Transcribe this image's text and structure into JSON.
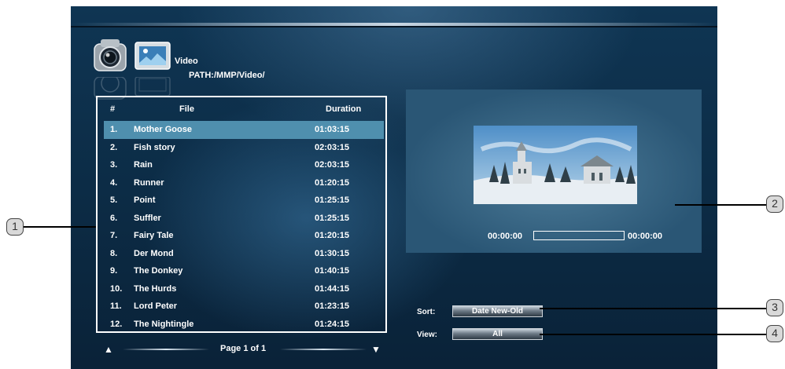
{
  "header": {
    "title": "Video",
    "path": "PATH:/MMP/Video/"
  },
  "list": {
    "columns": {
      "num": "#",
      "file": "File",
      "duration": "Duration"
    },
    "rows": [
      {
        "num": "1.",
        "file": "Mother Goose",
        "duration": "01:03:15",
        "selected": true
      },
      {
        "num": "2.",
        "file": "Fish story",
        "duration": "02:03:15"
      },
      {
        "num": "3.",
        "file": "Rain",
        "duration": "02:03:15"
      },
      {
        "num": "4.",
        "file": "Runner",
        "duration": "01:20:15"
      },
      {
        "num": "5.",
        "file": "Point",
        "duration": "01:25:15"
      },
      {
        "num": "6.",
        "file": "Suffler",
        "duration": "01:25:15"
      },
      {
        "num": "7.",
        "file": "Fairy Tale",
        "duration": "01:20:15"
      },
      {
        "num": "8.",
        "file": "Der Mond",
        "duration": "01:30:15"
      },
      {
        "num": "9.",
        "file": "The Donkey",
        "duration": "01:40:15"
      },
      {
        "num": "10.",
        "file": "The Hurds",
        "duration": "01:44:15"
      },
      {
        "num": "11.",
        "file": "Lord Peter",
        "duration": "01:23:15"
      },
      {
        "num": "12.",
        "file": "The Nightingle",
        "duration": "01:24:15"
      }
    ]
  },
  "pager": {
    "up_icon": "▲",
    "down_icon": "▼",
    "label": "Page 1 of 1"
  },
  "preview": {
    "time_start": "00:00:00",
    "time_end": "00:00:00",
    "progress_fraction": 0
  },
  "controls": {
    "sort_label": "Sort:",
    "sort_value": "Date New-Old",
    "view_label": "View:",
    "view_value": "All"
  },
  "callouts": [
    "1",
    "2",
    "3",
    "4"
  ],
  "colors": {
    "background": "#0c2c46",
    "selection": "#4f8fae",
    "preview_panel": "#3a6886"
  }
}
